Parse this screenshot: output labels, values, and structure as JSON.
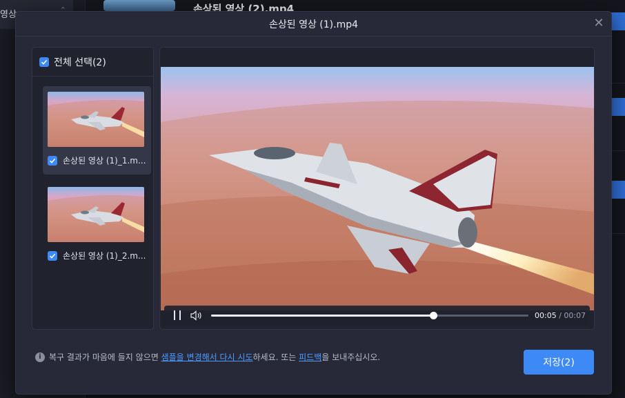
{
  "background": {
    "sidebar_item_label": "영상",
    "title": "손상된 영상 (2).mp4"
  },
  "modal": {
    "title": "손상된 영상 (1).mp4",
    "close_symbol": "✕",
    "select_all_label": "전체 선택(2)",
    "items": [
      {
        "label": "손상된 영상 (1)_1.m...",
        "checked": true,
        "selected": true
      },
      {
        "label": "손상된 영상 (1)_2.m...",
        "checked": true,
        "selected": false
      }
    ],
    "player": {
      "current_time": "00:05",
      "separator": "/",
      "duration": "00:07",
      "progress_fraction": 0.7
    },
    "footer": {
      "info_symbol": "i",
      "text_before": "복구 결과가 마음에 들지 않으면 ",
      "link_change_sample": "샘플을 변경해서 다시 시도",
      "text_middle": "하세요. 또는 ",
      "link_feedback": "피드백",
      "text_after": "을 보내주십시오."
    },
    "save_label": "저장(2)"
  },
  "colors": {
    "accent": "#3d8af7",
    "link": "#4e9bff",
    "modal_bg": "#272938",
    "panel_bg": "#20222e"
  },
  "icons": [
    "close-icon",
    "checkbox-checked-icon",
    "pause-icon",
    "volume-icon",
    "info-icon"
  ]
}
